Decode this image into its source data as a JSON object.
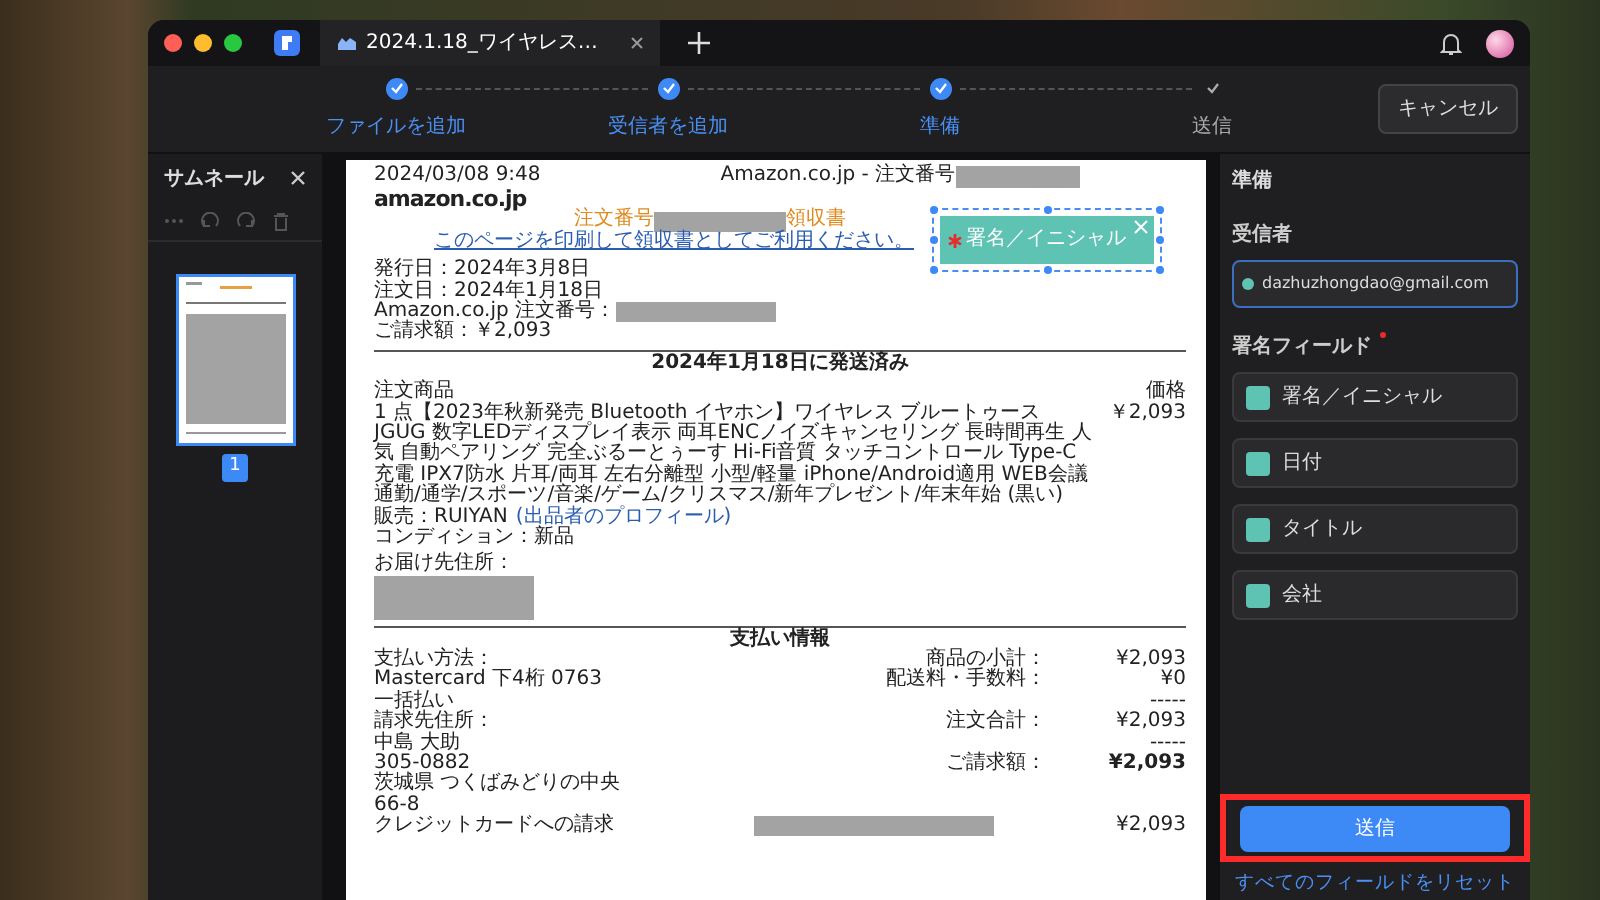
{
  "tab": {
    "title": "2024.1.18_ワイヤレス…"
  },
  "steps": [
    {
      "label": "ファイルを追加",
      "done": true
    },
    {
      "label": "受信者を追加",
      "done": true
    },
    {
      "label": "準備",
      "done": true
    },
    {
      "label": "送信",
      "done": false
    }
  ],
  "cancel_button": "キャンセル",
  "thumbnails": {
    "title": "サムネール",
    "pages": [
      {
        "number": "1",
        "selected": true
      }
    ]
  },
  "document": {
    "timestamp": "2024/03/08 9:48",
    "header": "Amazon.co.jp - 注文番号",
    "logo": "amazon.co.jp",
    "receipt_title_start": "注文番号",
    "receipt_title_end": "領収書",
    "print_link": "このページを印刷して領収書としてご利用ください。",
    "summary": [
      {
        "kind": "text",
        "label": "発行日：",
        "value": "2024年3月8日"
      },
      {
        "kind": "text",
        "label": "注文日：",
        "value": "2024年1月18日"
      },
      {
        "kind": "redacted",
        "label": "Amazon.co.jp 注文番号："
      },
      {
        "kind": "text",
        "label": "ご請求額：",
        "value": "￥2,093"
      }
    ],
    "shipment_heading": "2024年1月18日に発送済み",
    "items_header": "注文商品",
    "price_header": "価格",
    "item": {
      "description": "1 点【2023年秋新発売 Bluetooth イヤホン】ワイヤレス ブルートゥース JGUG 数字LEDディスプレイ表示 両耳ENCノイズキャンセリング 長時間再生 人気 自動ペアリング 完全ぶるーとぅーす Hi-Fi音質 タッチコントロール Type-C充電 IPX7防水 片耳/両耳 左右分離型 小型/軽量 iPhone/Android適用 WEB会議通勤/通学/スポーツ/音楽/ゲーム/クリスマス/新年プレゼント/年末年始 (黒い)",
      "price": "￥2,093"
    },
    "seller_label": "販売：RUIYAN",
    "seller_link": "(出品者のプロフィール)",
    "condition": "コンディション：新品",
    "shipping_label": "お届け先住所：",
    "payment_heading": "支払い情報",
    "payment_method": {
      "label": "支払い方法：",
      "lines": [
        "Mastercard  下4桁 0763",
        "一括払い"
      ]
    },
    "billing_address": {
      "label": "請求先住所：",
      "lines": [
        "中島 大助",
        "305-0882",
        "茨城県 つくばみどりの中央",
        "66-8"
      ]
    },
    "totals": [
      {
        "kind": "row",
        "label": "商品の小計：",
        "value": "¥2,093",
        "bold": false
      },
      {
        "kind": "row",
        "label": "配送料・手数料：",
        "value": "¥0",
        "bold": false
      },
      {
        "kind": "dashes",
        "value": "-----"
      },
      {
        "kind": "row",
        "label": "注文合計：",
        "value": "¥2,093",
        "bold": false
      },
      {
        "kind": "dashes",
        "value": "-----"
      },
      {
        "kind": "row",
        "label": "ご請求額：",
        "value": "¥2,093",
        "bold": true
      }
    ],
    "card_charge": {
      "label": "クレジットカードへの請求",
      "value": "¥2,093"
    },
    "signature_field": {
      "label": "署名／イニシャル",
      "required": true,
      "selected": true
    }
  },
  "prepare": {
    "title": "準備",
    "recipient_label": "受信者",
    "recipient": "dazhuzhongdao@gmail.com",
    "fields_label": "署名フィールド",
    "fields_required": true,
    "fields": [
      {
        "label": "署名／イニシャル"
      },
      {
        "label": "日付"
      },
      {
        "label": "タイトル"
      },
      {
        "label": "会社"
      }
    ],
    "send_button": "送信",
    "reset_link": "すべてのフィールドをリセット"
  }
}
